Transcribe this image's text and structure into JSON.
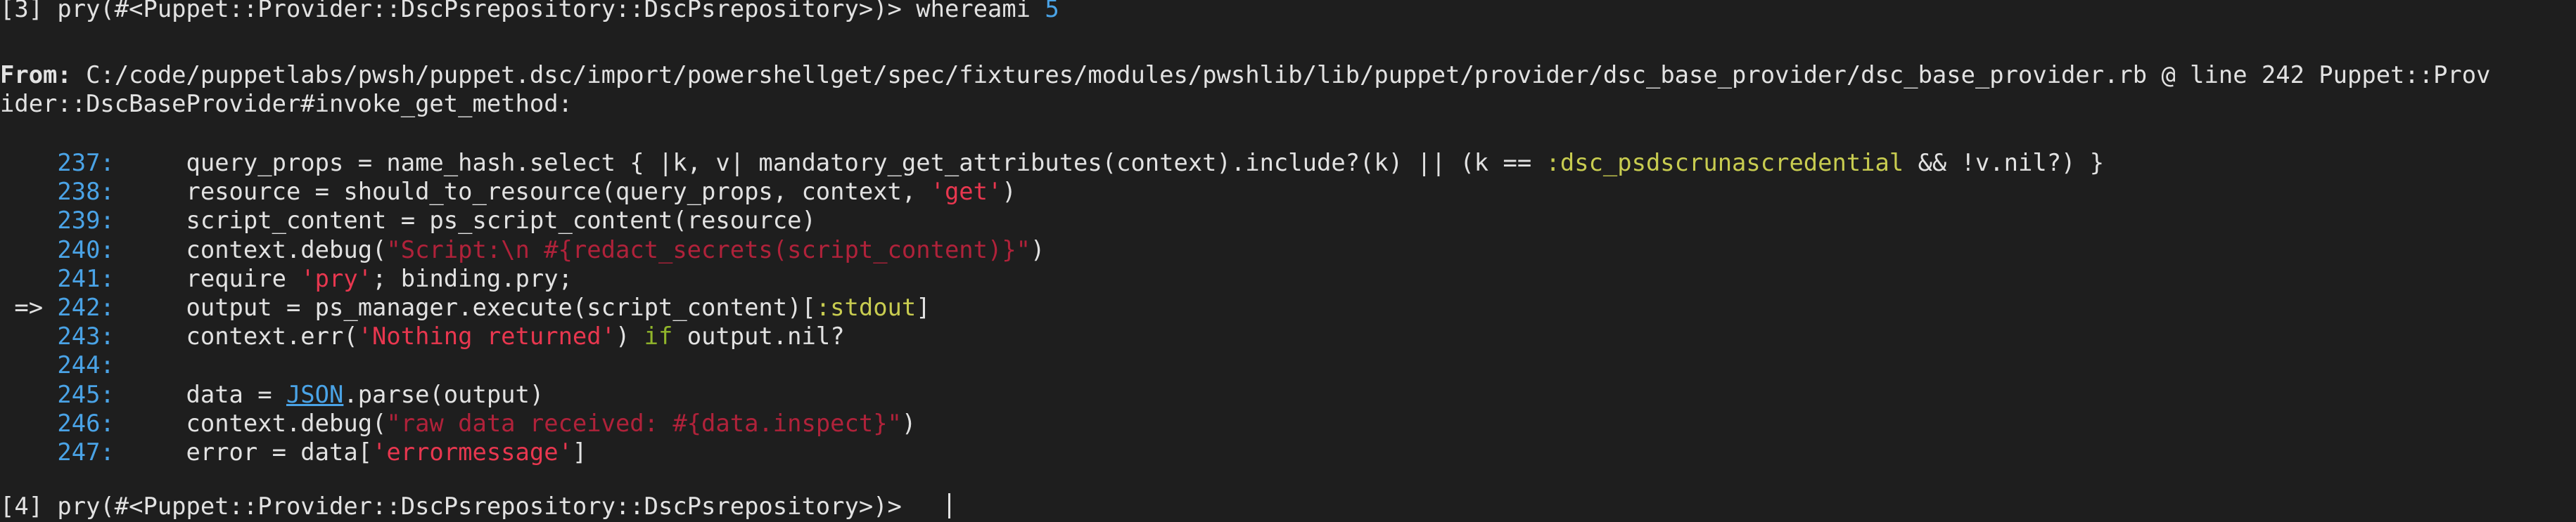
{
  "prompt": {
    "first": "[3] pry(#<Puppet::Provider::DscPsrepository::DscPsrepository>)> ",
    "first_command": "whereami ",
    "first_arg": "5",
    "second": "[4] pry(#<Puppet::Provider::DscPsrepository::DscPsrepository>)> "
  },
  "header": {
    "from_label": "From:",
    "from_text": " C:/code/puppetlabs/pwsh/puppet.dsc/import/powershellget/spec/fixtures/modules/pwshlib/lib/puppet/provider/dsc_base_provider/dsc_base_provider.rb @ line 242 Puppet::Prov",
    "from_wrap": "ider::DscBaseProvider#invoke_get_method:"
  },
  "code": {
    "marker": " => ",
    "lines": [
      {
        "num": "237:",
        "parts": [
          {
            "t": "     query_props = name_hash.select { |k, v| mandatory_get_attributes(context).include?(k) || (k == ",
            "c": ""
          },
          {
            "t": ":dsc_psdscrunascredential",
            "c": "sym"
          },
          {
            "t": " && !v.nil?) }",
            "c": ""
          }
        ]
      },
      {
        "num": "238:",
        "parts": [
          {
            "t": "     resource = should_to_resource(query_props, context, ",
            "c": ""
          },
          {
            "t": "'get'",
            "c": "str"
          },
          {
            "t": ")",
            "c": ""
          }
        ]
      },
      {
        "num": "239:",
        "parts": [
          {
            "t": "     script_content = ps_script_content(resource)",
            "c": ""
          }
        ]
      },
      {
        "num": "240:",
        "parts": [
          {
            "t": "     context.debug(",
            "c": ""
          },
          {
            "t": "\"Script:\\n #{redact_secrets(script_content)}\"",
            "c": "strd"
          },
          {
            "t": ")",
            "c": ""
          }
        ]
      },
      {
        "num": "241:",
        "parts": [
          {
            "t": "     require ",
            "c": ""
          },
          {
            "t": "'pry'",
            "c": "str"
          },
          {
            "t": "; binding.pry;",
            "c": ""
          }
        ]
      },
      {
        "num": "242:",
        "parts": [
          {
            "t": "     output = ps_manager.execute(script_content)[",
            "c": ""
          },
          {
            "t": ":stdout",
            "c": "sym"
          },
          {
            "t": "]",
            "c": ""
          }
        ]
      },
      {
        "num": "243:",
        "parts": [
          {
            "t": "     context.err(",
            "c": ""
          },
          {
            "t": "'Nothing returned'",
            "c": "str"
          },
          {
            "t": ") ",
            "c": ""
          },
          {
            "t": "if",
            "c": "kw"
          },
          {
            "t": " output.nil?",
            "c": ""
          }
        ]
      },
      {
        "num": "244:",
        "parts": []
      },
      {
        "num": "245:",
        "parts": [
          {
            "t": "     data = ",
            "c": ""
          },
          {
            "t": "JSON",
            "c": "link"
          },
          {
            "t": ".parse(output)",
            "c": ""
          }
        ]
      },
      {
        "num": "246:",
        "parts": [
          {
            "t": "     context.debug(",
            "c": ""
          },
          {
            "t": "\"raw data received: #{data.inspect}\"",
            "c": "strd"
          },
          {
            "t": ")",
            "c": ""
          }
        ]
      },
      {
        "num": "247:",
        "parts": [
          {
            "t": "     error = data[",
            "c": ""
          },
          {
            "t": "'errormessage'",
            "c": "str"
          },
          {
            "t": "]",
            "c": ""
          }
        ]
      }
    ]
  },
  "colors": {
    "background": "#1e1e1e",
    "text": "#e2e2e2",
    "line_number": "#4aa3e6",
    "string": "#e8374f",
    "string_interp": "#b0223a",
    "symbol": "#c8cc50",
    "keyword": "#91b62b"
  }
}
